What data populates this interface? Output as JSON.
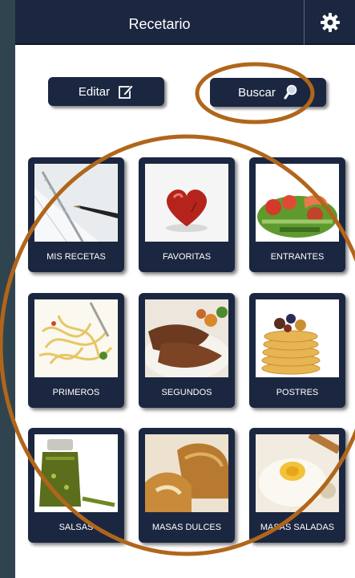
{
  "header": {
    "title": "Recetario",
    "settings_icon": "gear-icon"
  },
  "toolbar": {
    "edit_label": "Editar",
    "edit_icon": "edit-icon",
    "search_label": "Buscar",
    "search_icon": "search-icon"
  },
  "categories": [
    {
      "label": "MIS RECETAS",
      "image": "notebook-pen"
    },
    {
      "label": "FAVORITAS",
      "image": "red-heart-stone"
    },
    {
      "label": "ENTRANTES",
      "image": "salad-shrimp"
    },
    {
      "label": "PRIMEROS",
      "image": "spaghetti"
    },
    {
      "label": "SEGUNDOS",
      "image": "roast-meat"
    },
    {
      "label": "POSTRES",
      "image": "pancakes"
    },
    {
      "label": "SALSAS",
      "image": "pesto-jar"
    },
    {
      "label": "MASAS DULCES",
      "image": "sweet-bread"
    },
    {
      "label": "MASAS SALADAS",
      "image": "flour-egg"
    }
  ],
  "colors": {
    "navy": "#1b2740",
    "annotation": "#b0661a",
    "background": "#2f444f"
  }
}
